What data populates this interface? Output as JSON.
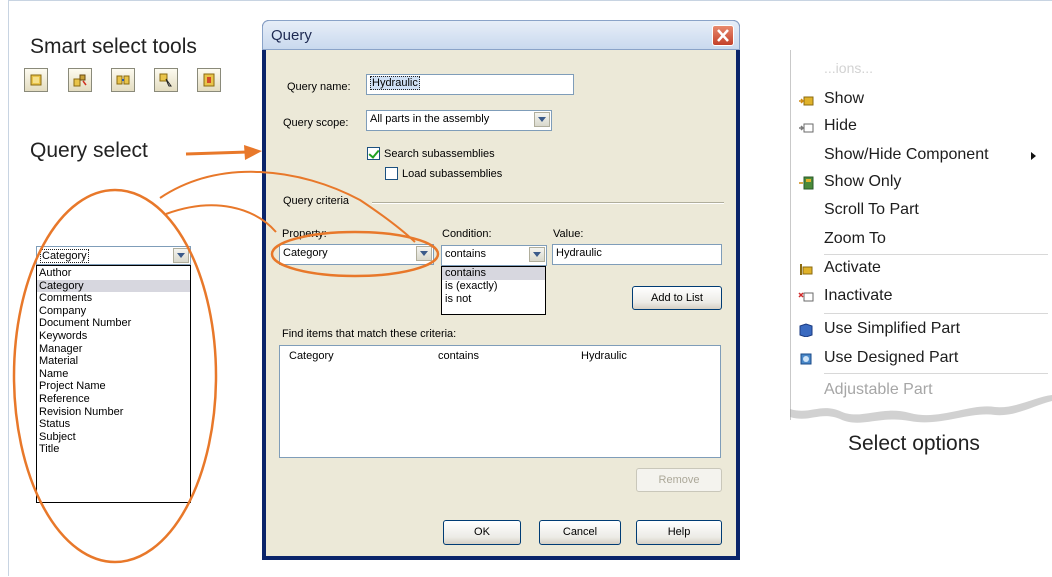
{
  "labels": {
    "smart_select_tools": "Smart select tools",
    "query_select": "Query select",
    "select_options": "Select options"
  },
  "tools": [
    {
      "icon": "select-component-icon"
    },
    {
      "icon": "select-by-size-icon"
    },
    {
      "icon": "select-similar-icon"
    },
    {
      "icon": "select-by-plane-icon"
    },
    {
      "icon": "select-internal-icon"
    }
  ],
  "category_combo": {
    "value": "Category",
    "options": [
      "Author",
      "Category",
      "Comments",
      "Company",
      "Document Number",
      "Keywords",
      "Manager",
      "Material",
      "Name",
      "Project Name",
      "Reference",
      "Revision Number",
      "Status",
      "Subject",
      "Title"
    ],
    "selected": "Category"
  },
  "dialog": {
    "title": "Query",
    "query_name_label": "Query name:",
    "query_name_value": "Hydraulic",
    "query_scope_label": "Query scope:",
    "query_scope_value": "All parts in the assembly",
    "search_subassemblies": "Search subassemblies",
    "load_subassemblies": "Load subassemblies",
    "query_criteria": "Query criteria",
    "property_label": "Property:",
    "property_value": "Category",
    "condition_label": "Condition:",
    "condition_value": "contains",
    "condition_options": [
      "contains",
      "is (exactly)",
      "is not"
    ],
    "value_label": "Value:",
    "value_value": "Hydraulic",
    "add_to_list": "Add to List",
    "find_items_label": "Find items that match these criteria:",
    "results": [
      {
        "property": "Category",
        "condition": "contains",
        "value": "Hydraulic"
      }
    ],
    "remove": "Remove",
    "ok": "OK",
    "cancel": "Cancel",
    "help": "Help"
  },
  "menu": {
    "partial_top": "...ions...",
    "items": [
      {
        "label": "Show",
        "icon": "show-icon"
      },
      {
        "label": "Hide",
        "icon": "hide-icon"
      },
      {
        "label": "Show/Hide Component",
        "icon": ""
      },
      {
        "label": "Show Only",
        "icon": "show-only-icon"
      },
      {
        "label": "Scroll To Part",
        "icon": ""
      },
      {
        "label": "Zoom To",
        "icon": ""
      },
      {
        "label": "Activate",
        "icon": "activate-icon"
      },
      {
        "label": "Inactivate",
        "icon": "inactivate-icon"
      },
      {
        "label": "Use Simplified Part",
        "icon": "simplified-part-icon"
      },
      {
        "label": "Use Designed Part",
        "icon": "designed-part-icon"
      },
      {
        "label": "Adjustable Part",
        "icon": ""
      }
    ]
  },
  "colors": {
    "annotation_orange": "#e8782a",
    "dialog_face": "#ece9d8",
    "xp_border": "#0a246a"
  }
}
